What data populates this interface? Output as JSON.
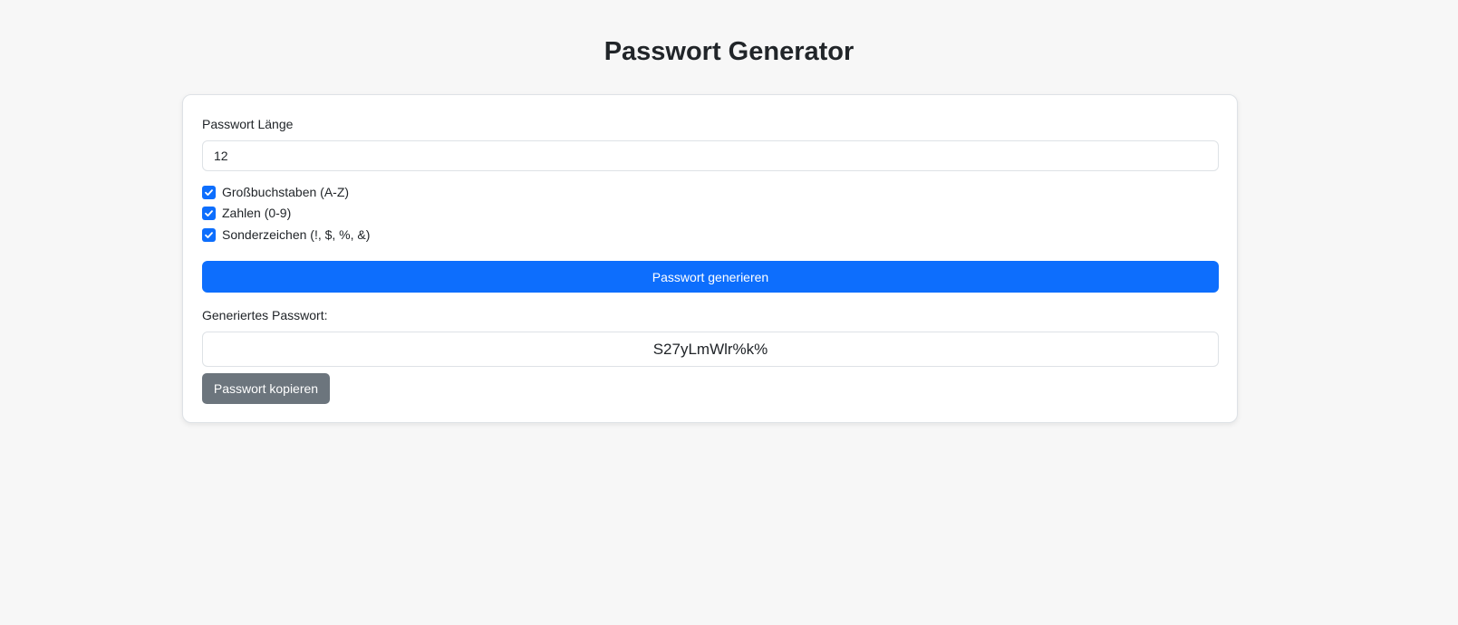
{
  "page": {
    "title": "Passwort Generator"
  },
  "form": {
    "length_label": "Passwort Länge",
    "length_value": "12",
    "options": [
      {
        "label": "Großbuchstaben (A-Z)",
        "checked": true
      },
      {
        "label": "Zahlen (0-9)",
        "checked": true
      },
      {
        "label": "Sonderzeichen (!, $, %, &)",
        "checked": true
      }
    ],
    "generate_label": "Passwort generieren",
    "generated_label": "Generiertes Passwort:",
    "generated_value": "S27yLmWlr%k%",
    "copy_label": "Passwort kopieren"
  },
  "colors": {
    "primary": "#0d6efd",
    "secondary": "#6c757d",
    "background": "#f7f7f7",
    "check_icon": "check-icon"
  }
}
